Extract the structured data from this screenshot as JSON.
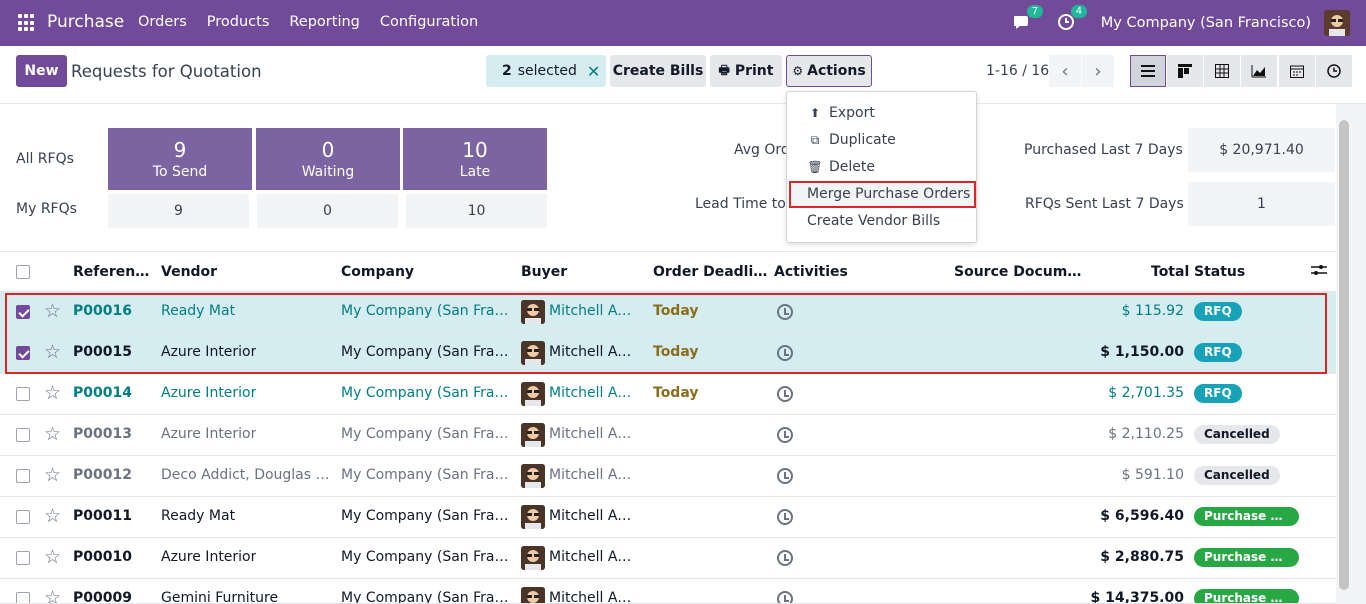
{
  "navbar": {
    "app_name": "Purchase",
    "menu": [
      "Orders",
      "Products",
      "Reporting",
      "Configuration"
    ],
    "messages_count": "7",
    "activities_count": "4",
    "company": "My Company (San Francisco)"
  },
  "control": {
    "new_label": "New",
    "title": "Requests for Quotation",
    "selected_count": "2",
    "selected_label": "selected",
    "create_bills": "Create Bills",
    "print": "Print",
    "actions": "Actions",
    "pager": "1-16 / 16"
  },
  "dashboard": {
    "all_rfqs": "All RFQs",
    "my_rfqs": "My RFQs",
    "tiles": [
      {
        "num": "9",
        "label": "To Send",
        "mine": "9"
      },
      {
        "num": "0",
        "label": "Waiting",
        "mine": "0"
      },
      {
        "num": "10",
        "label": "Late",
        "mine": "10"
      }
    ],
    "avg_order": "Avg Ord",
    "lead_time": "Lead Time to P",
    "purchased_label": "Purchased Last 7 Days",
    "purchased_value": "$ 20,971.40",
    "rfqs_sent_label": "RFQs Sent Last 7 Days",
    "rfqs_sent_value": "1"
  },
  "actions_menu": {
    "export": "Export",
    "duplicate": "Duplicate",
    "delete": "Delete",
    "merge": "Merge Purchase Orders",
    "create_vendor_bills": "Create Vendor Bills"
  },
  "table": {
    "headers": {
      "reference": "Referen…",
      "vendor": "Vendor",
      "company": "Company",
      "buyer": "Buyer",
      "deadline": "Order Deadli…",
      "activities": "Activities",
      "source": "Source Docum…",
      "total": "Total",
      "status": "Status"
    },
    "rows": [
      {
        "ref": "P00016",
        "vendor": "Ready Mat",
        "company": "My Company (San Franci…",
        "buyer": "Mitchell Ad…",
        "deadline": "Today",
        "total": "$ 115.92",
        "status": "RFQ"
      },
      {
        "ref": "P00015",
        "vendor": "Azure Interior",
        "company": "My Company (San Franci…",
        "buyer": "Mitchell Ad…",
        "deadline": "Today",
        "total": "$ 1,150.00",
        "status": "RFQ"
      },
      {
        "ref": "P00014",
        "vendor": "Azure Interior",
        "company": "My Company (San Franci…",
        "buyer": "Mitchell Ad…",
        "deadline": "Today",
        "total": "$ 2,701.35",
        "status": "RFQ"
      },
      {
        "ref": "P00013",
        "vendor": "Azure Interior",
        "company": "My Company (San Franci…",
        "buyer": "Mitchell Ad…",
        "deadline": "",
        "total": "$ 2,110.25",
        "status": "Cancelled"
      },
      {
        "ref": "P00012",
        "vendor": "Deco Addict, Douglas Fl…",
        "company": "My Company (San Franci…",
        "buyer": "Mitchell Ad…",
        "deadline": "",
        "total": "$ 591.10",
        "status": "Cancelled"
      },
      {
        "ref": "P00011",
        "vendor": "Ready Mat",
        "company": "My Company (San Franci…",
        "buyer": "Mitchell Ad…",
        "deadline": "",
        "total": "$ 6,596.40",
        "status": "Purchase Or…"
      },
      {
        "ref": "P00010",
        "vendor": "Azure Interior",
        "company": "My Company (San Franci…",
        "buyer": "Mitchell Ad…",
        "deadline": "",
        "total": "$ 2,880.75",
        "status": "Purchase Or…"
      },
      {
        "ref": "P00009",
        "vendor": "Gemini Furniture",
        "company": "My Company (San Franci…",
        "buyer": "Mitchell Ad…",
        "deadline": "",
        "total": "$ 14,375.00",
        "status": "Purchase Or…"
      }
    ]
  }
}
